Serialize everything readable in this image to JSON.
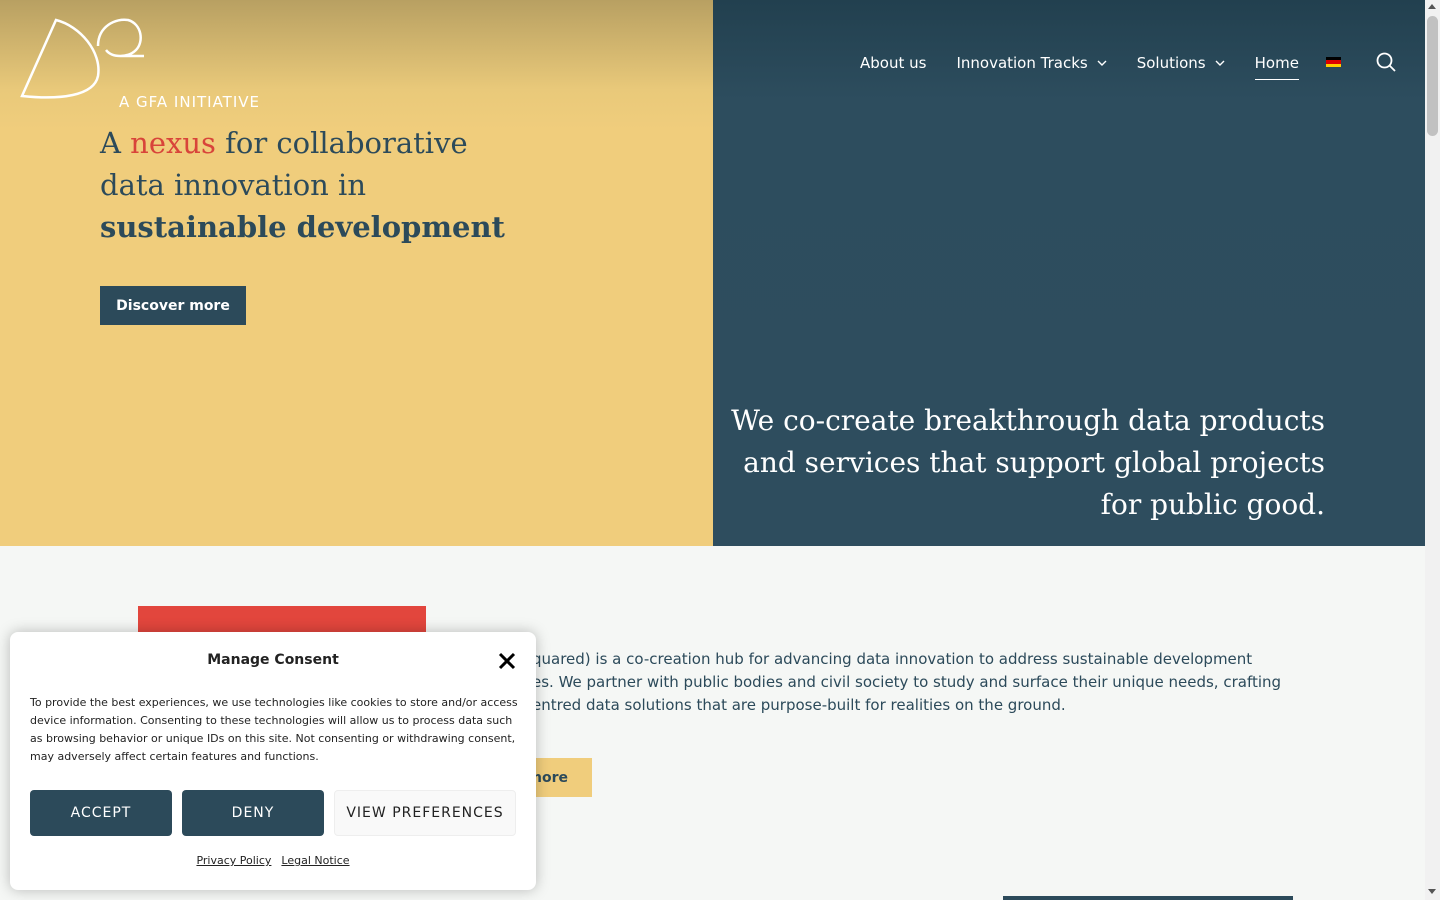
{
  "brand": {
    "logo_text": "A GFA INITIATIVE"
  },
  "nav": {
    "items": [
      {
        "label": "About us"
      },
      {
        "label": "Innovation Tracks"
      },
      {
        "label": "Solutions"
      },
      {
        "label": "Home"
      }
    ]
  },
  "hero": {
    "headline_part1": "A ",
    "headline_accent": "nexus",
    "headline_part2": " for collaborative",
    "headline_line2": "data innovation in",
    "headline_bold": "sustainable development",
    "cta_label": "Discover more",
    "tagline": "We co-create breakthrough data products and services that support global projects for public good."
  },
  "intro": {
    "text": "quared) is a co-creation hub for advancing data innovation to address sustainable development es. We partner with public bodies and civil society to study and surface their unique needs, crafting entred data solutions that are purpose-built for realities on the ground.",
    "line1": "quared) is a co-creation hub for advancing data innovation to address sustainable development",
    "line2": "es. We partner with public bodies and civil society to study and surface their unique needs, crafting",
    "line3": "entred data solutions that are purpose-built for realities on the ground.",
    "more_label": "more"
  },
  "consent": {
    "title": "Manage Consent",
    "body": "To provide the best experiences, we use technologies like cookies to store and/or access device information. Consenting to these technologies will allow us to process data such as browsing behavior or unique IDs on this site. Not consenting or withdrawing consent, may adversely affect certain features and functions.",
    "accept_label": "ACCEPT",
    "deny_label": "DENY",
    "prefs_label": "VIEW PREFERENCES",
    "privacy_link": "Privacy Policy",
    "legal_link": "Legal Notice"
  },
  "colors": {
    "navy": "#2c4a5a",
    "yellow": "#f0cd7c",
    "red": "#e2463d"
  },
  "icons": {
    "search": "search-icon",
    "close": "close-icon",
    "chevron": "chevron-down-icon",
    "flag": "german-flag-icon"
  }
}
